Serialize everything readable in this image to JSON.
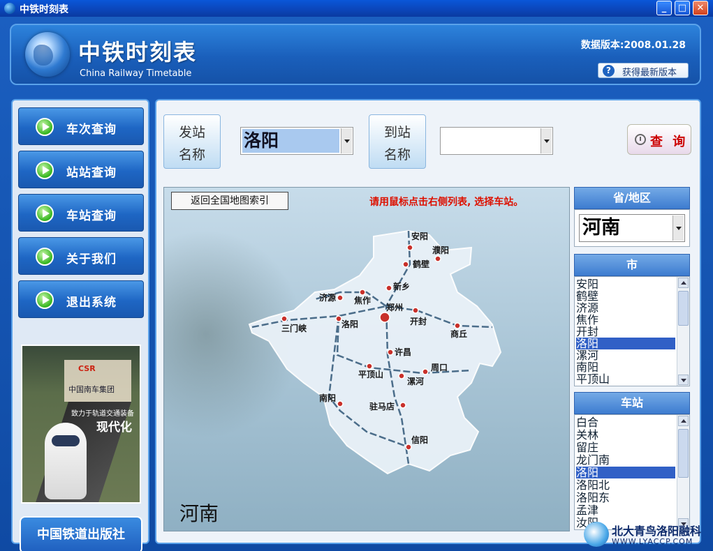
{
  "window": {
    "title": "中铁时刻表",
    "minimize": "_",
    "maximize": "□",
    "close": "✕"
  },
  "header": {
    "cn_title": "中铁时刻表",
    "en_title": "China Railway Timetable",
    "version": "数据版本:2008.01.28",
    "update_button": "获得最新版本",
    "update_icon": "question-icon"
  },
  "nav": {
    "items": [
      {
        "label": "车次查询",
        "icon": "play-icon"
      },
      {
        "label": "站站查询",
        "icon": "play-icon"
      },
      {
        "label": "车站查询",
        "icon": "play-icon"
      },
      {
        "label": "关于我们",
        "icon": "play-icon"
      },
      {
        "label": "退出系统",
        "icon": "play-icon"
      }
    ]
  },
  "ad": {
    "logo": "CSR",
    "company": "中国南车集团",
    "slogan": "致力于轨道交通装备",
    "modern": "现代化"
  },
  "publisher": "中国铁道出版社",
  "search": {
    "from_label_1": "发站",
    "from_label_2": "名称",
    "from_value": "洛阳",
    "to_label_1": "到站",
    "to_label_2": "名称",
    "to_value": "",
    "query_button": "查 询"
  },
  "map": {
    "back_button": "返回全国地图索引",
    "hint": "请用鼠标点击右侧列表, 选择车站。",
    "province_label": "河南",
    "cities": [
      "安阳",
      "濮阳",
      "鹤壁",
      "新乡",
      "济源",
      "焦作",
      "郑州",
      "开封",
      "三门峡",
      "洛阳",
      "商丘",
      "许昌",
      "平顶山",
      "周口",
      "漯河",
      "南阳",
      "驻马店",
      "信阳"
    ]
  },
  "province_panel": {
    "header": "省/地区",
    "value": "河南"
  },
  "city_panel": {
    "header": "市",
    "items": [
      "安阳",
      "鹤壁",
      "济源",
      "焦作",
      "开封",
      "洛阳",
      "漯河",
      "南阳",
      "平顶山"
    ],
    "selected": "洛阳"
  },
  "station_panel": {
    "header": "车站",
    "items": [
      "白合",
      "关林",
      "留庄",
      "龙门南",
      "洛阳",
      "洛阳北",
      "洛阳东",
      "孟津",
      "汝阳"
    ],
    "selected": "洛阳"
  },
  "watermark": {
    "cn": "北大青鸟洛阳融科",
    "url": "WWW.LYACCP.COM"
  }
}
